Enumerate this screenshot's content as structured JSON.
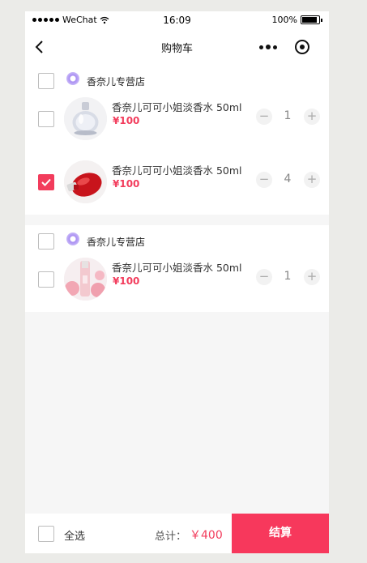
{
  "status_bar": {
    "carrier": "WeChat",
    "time": "16:09",
    "battery": "100%"
  },
  "nav": {
    "title": "购物车"
  },
  "shops": [
    {
      "name": "香奈儿专营店",
      "checked": false,
      "items": [
        {
          "title": "香奈儿可可小姐淡香水 50ml",
          "price": "¥100",
          "quantity": "1",
          "checked": false,
          "image": "silver-perfume-bottle"
        },
        {
          "title": "香奈儿可可小姐淡香水 50ml",
          "price": "¥100",
          "quantity": "4",
          "checked": true,
          "image": "red-perfume-bottle"
        }
      ]
    },
    {
      "name": "香奈儿专营店",
      "checked": false,
      "items": [
        {
          "title": "香奈儿可可小姐淡香水 50ml",
          "price": "¥100",
          "quantity": "1",
          "checked": false,
          "image": "pink-perfume-roses"
        }
      ]
    }
  ],
  "stepper": {
    "minus": "−",
    "plus": "+"
  },
  "footer": {
    "select_all_label": "全选",
    "total_label": "总计：",
    "total_value": "￥400",
    "checkout_label": "结算"
  },
  "colors": {
    "accent": "#f23c5c",
    "checkout": "#f7385c"
  }
}
